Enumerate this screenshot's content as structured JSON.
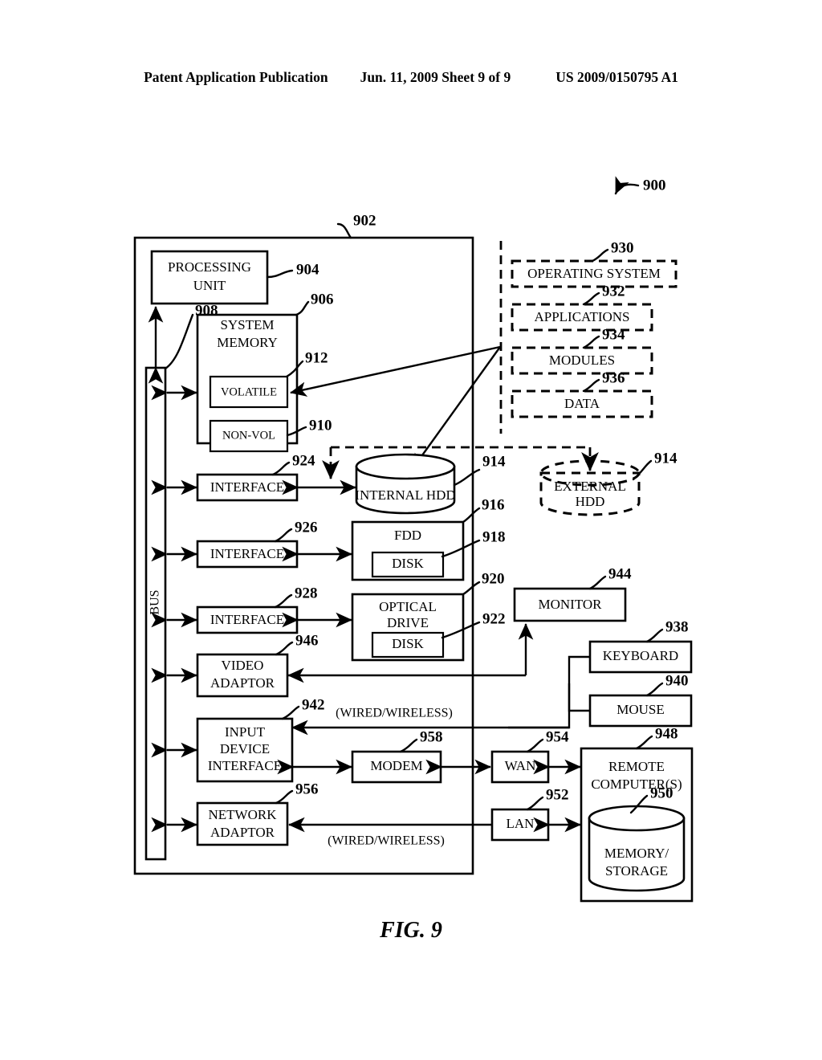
{
  "header": {
    "publication": "Patent Application Publication",
    "date_sheet": "Jun. 11, 2009  Sheet 9 of 9",
    "patent_number": "US 2009/0150795 A1"
  },
  "figure": {
    "caption": "FIG. 9",
    "top_ref": "900"
  },
  "blocks": {
    "computer_boundary": {
      "ref": "902"
    },
    "processing_unit": {
      "label_line1": "PROCESSING",
      "label_line2": "UNIT",
      "ref": "904"
    },
    "system_memory": {
      "label_line1": "SYSTEM",
      "label_line2": "MEMORY",
      "ref": "906"
    },
    "bus": {
      "label": "BUS",
      "ref": "908"
    },
    "volatile": {
      "label": "VOLATILE",
      "ref": "912"
    },
    "non_volatile": {
      "label": "NON-VOL",
      "ref": "910"
    },
    "interface_hdd": {
      "label": "INTERFACE",
      "ref": "924"
    },
    "interface_fdd": {
      "label": "INTERFACE",
      "ref": "926"
    },
    "interface_optical": {
      "label": "INTERFACE",
      "ref": "928"
    },
    "video_adaptor": {
      "label_line1": "VIDEO",
      "label_line2": "ADAPTOR",
      "ref": "946"
    },
    "input_device_interface": {
      "label_line1": "INPUT",
      "label_line2": "DEVICE",
      "label_line3": "INTERFACE",
      "ref": "942"
    },
    "network_adaptor": {
      "label_line1": "NETWORK",
      "label_line2": "ADAPTOR",
      "ref": "956"
    },
    "internal_hdd": {
      "label": "INTERNAL HDD",
      "ref": "914"
    },
    "external_hdd": {
      "label_line1": "EXTERNAL",
      "label_line2": "HDD",
      "ref": "914"
    },
    "fdd": {
      "label": "FDD",
      "ref": "916"
    },
    "fdd_disk": {
      "label": "DISK",
      "ref": "918"
    },
    "optical_drive": {
      "label_line1": "OPTICAL",
      "label_line2": "DRIVE",
      "ref": "920"
    },
    "optical_disk": {
      "label": "DISK",
      "ref": "922"
    },
    "monitor": {
      "label": "MONITOR",
      "ref": "944"
    },
    "keyboard": {
      "label": "KEYBOARD",
      "ref": "938"
    },
    "mouse": {
      "label": "MOUSE",
      "ref": "940"
    },
    "modem": {
      "label": "MODEM",
      "ref": "958"
    },
    "wan": {
      "label": "WAN",
      "ref": "954"
    },
    "lan": {
      "label": "LAN",
      "ref": "952"
    },
    "remote_computers": {
      "label_line1": "REMOTE",
      "label_line2": "COMPUTER(S)",
      "ref": "948"
    },
    "memory_storage": {
      "label_line1": "MEMORY/",
      "label_line2": "STORAGE",
      "ref": "950"
    }
  },
  "software": {
    "operating_system": {
      "label": "OPERATING SYSTEM",
      "ref": "930"
    },
    "applications": {
      "label": "APPLICATIONS",
      "ref": "932"
    },
    "modules": {
      "label": "MODULES",
      "ref": "934"
    },
    "data": {
      "label": "DATA",
      "ref": "936"
    }
  },
  "annotations": {
    "wired_wireless_top": "(WIRED/WIRELESS)",
    "wired_wireless_bottom": "(WIRED/WIRELESS)"
  }
}
